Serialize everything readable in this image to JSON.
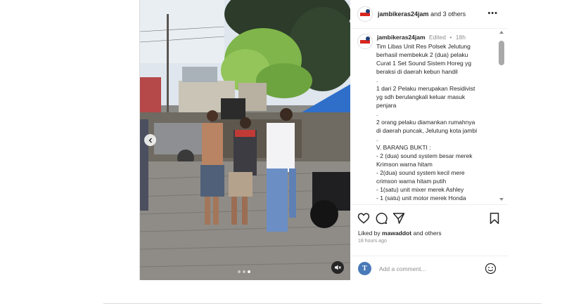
{
  "header": {
    "username": "jambikeras24jam",
    "coauthors": "and 3 others",
    "more_icon": "more-horizontal-icon"
  },
  "caption": {
    "username": "jambikeras24jam",
    "edited": "Edited",
    "time": "18h",
    "lines": [
      "Tim Libas Unit Res Polsek Jelutung",
      "berhasil membekuk 2 (dua) pelaku",
      "Curat 1 Set Sound Sistem Horeg yg",
      "beraksi di daerah kebun handil",
      ".",
      "1 dari 2 Pelaku merupakan Residivist",
      "yg sdh berulangkali keluar masuk",
      "penjara",
      ".",
      "2 orang pelaku diamankan rumahnya",
      "di daerah puncak, Jelutung kota jambi",
      ".",
      "V. BARANG BUKTI :",
      "- 2 (dua) sound system besar merek",
      "Krimson warna hitam",
      "- 2(dua) sound system kecil mere",
      "crimson warna hitam putih",
      "- 1(satu) unit mixer merek Ashley",
      "- 1 (satu) unit motor merek Honda"
    ]
  },
  "actions": {
    "like_icon": "heart-icon",
    "comment_icon": "comment-icon",
    "share_icon": "send-icon",
    "save_icon": "bookmark-icon"
  },
  "likes": {
    "prefix": "Liked by",
    "user": "mawaddot",
    "suffix": "and others"
  },
  "timestamp": "18 hours ago",
  "comment": {
    "placeholder": "Add a comment...",
    "emoji_icon": "smiley-icon"
  },
  "carousel": {
    "total": 3,
    "active": 3
  },
  "colors": {
    "text": "#262626",
    "muted": "#8e8e8e",
    "border": "#dbdbdb",
    "brand_red": "#d7261e"
  }
}
